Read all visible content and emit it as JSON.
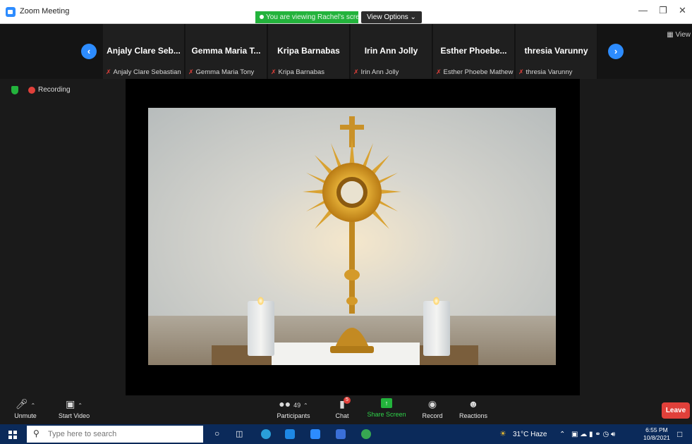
{
  "window": {
    "title": "Zoom Meeting",
    "viewing_banner": "You are viewing Rachel's screen",
    "view_options": "View Options ⌄",
    "view_button": "View"
  },
  "participants": [
    {
      "display": "Anjaly Clare Seb...",
      "full": "Anjaly Clare Sebastian"
    },
    {
      "display": "Gemma Maria T...",
      "full": "Gemma Maria Tony"
    },
    {
      "display": "Kripa Barnabas",
      "full": "Kripa Barnabas"
    },
    {
      "display": "Irin Ann Jolly",
      "full": "Irin Ann Jolly"
    },
    {
      "display": "Esther Phoebe...",
      "full": "Esther Phoebe Mathew"
    },
    {
      "display": "thresia Varunny",
      "full": "thresia Varunny"
    }
  ],
  "status": {
    "recording": "Recording"
  },
  "toolbar": {
    "unmute": "Unmute",
    "start_video": "Start Video",
    "participants": "Participants",
    "participant_count": "49",
    "chat": "Chat",
    "chat_badge": "5",
    "share_screen": "Share Screen",
    "record": "Record",
    "reactions": "Reactions",
    "leave": "Leave"
  },
  "taskbar": {
    "search_placeholder": "Type here to search",
    "weather": "31°C  Haze",
    "time": "6:55 PM",
    "date": "10/8/2021"
  },
  "colors": {
    "zoom_blue": "#2d8cff",
    "share_green": "#23b33c",
    "leave_red": "#e0403a",
    "taskbar_blue": "#0b2a5a"
  }
}
